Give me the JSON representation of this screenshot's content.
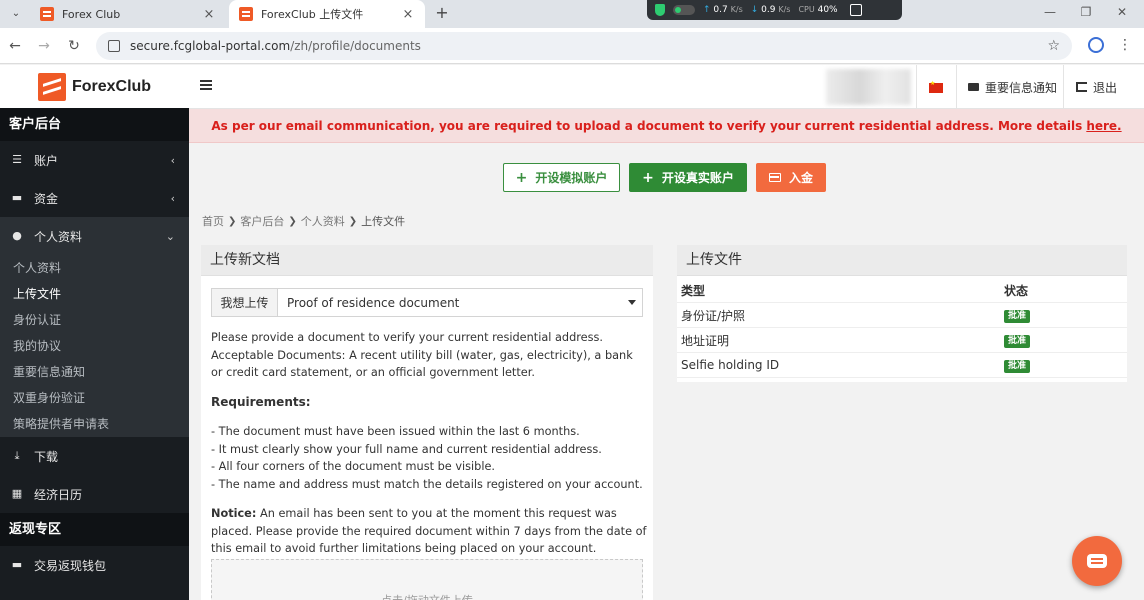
{
  "browser": {
    "tabs": [
      {
        "title": "Forex Club"
      },
      {
        "title": "ForexClub 上传文件"
      }
    ],
    "new_tab": "+",
    "url_host": "secure.fcglobal-portal.com",
    "url_path": "/zh/profile/documents",
    "net_monitor": {
      "up": "0.7",
      "down": "0.9",
      "unit": "K/s",
      "cpu_label": "CPU",
      "cpu_value": "40%"
    }
  },
  "brand": {
    "name": "ForexClub",
    "accent": "#ef5a26",
    "green": "#2f8b35"
  },
  "sidebar": {
    "section_client": "客户后台",
    "items": [
      {
        "label": "账户",
        "icon": "list-icon"
      },
      {
        "label": "资金",
        "icon": "wallet-icon"
      },
      {
        "label": "个人资料",
        "icon": "user-icon"
      }
    ],
    "profile_sub": [
      "个人资料",
      "上传文件",
      "身份认证",
      "我的协议",
      "重要信息通知",
      "双重身份验证",
      "策略提供者申请表"
    ],
    "items2": [
      {
        "label": "下载",
        "icon": "download-icon"
      },
      {
        "label": "经济日历",
        "icon": "calendar-icon"
      }
    ],
    "section_rebate": "返现专区",
    "items3": [
      {
        "label": "交易返现钱包",
        "icon": "wallet-icon"
      }
    ]
  },
  "header": {
    "notice_link": "重要信息通知",
    "logout": "退出"
  },
  "alert": {
    "text": "As per our email communication, you are required to upload a document to verify your current residential address. More details",
    "link": "here."
  },
  "actions": {
    "demo": "开设模拟账户",
    "real": "开设真实账户",
    "deposit": "入金"
  },
  "breadcrumb": [
    "首页",
    "客户后台",
    "个人资料",
    "上传文件"
  ],
  "upload": {
    "title": "上传新文档",
    "select_label": "我想上传",
    "select_value": "Proof of residence document",
    "desc1": "Please provide a document to verify your current residential address.",
    "desc2": "Acceptable Documents: A recent utility bill (water, gas, electricity), a bank or credit card statement, or an official government letter.",
    "requirements_title": "Requirements:",
    "requirements": [
      "- The document must have been issued within the last 6 months.",
      "- It must clearly show your full name and current residential address.",
      "- All four corners of the document must be visible.",
      "- The name and address must match the details registered on your account."
    ],
    "notice_label": "Notice:",
    "notice_text": "An email has been sent to you at the moment this request was placed. Please provide the required document within 7 days from the date of this email to avoid further limitations being placed on your account.",
    "dropzone": "点击/拖动文件上传"
  },
  "files": {
    "title": "上传文件",
    "col_type": "类型",
    "col_status": "状态",
    "rows": [
      {
        "type": "身份证/护照",
        "status": "批准"
      },
      {
        "type": "地址证明",
        "status": "批准"
      },
      {
        "type": "Selfie holding ID",
        "status": "批准"
      }
    ]
  }
}
